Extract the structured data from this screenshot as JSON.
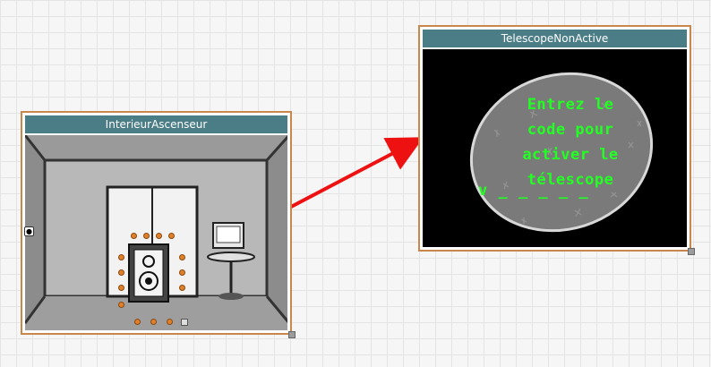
{
  "nodes": {
    "interior": {
      "title": "InterieurAscenseur"
    },
    "telescope": {
      "title": "TelescopeNonActive",
      "screen_text": "Entrez le code pour activer le télescope",
      "code_line": "v _ _ _ _ _"
    }
  },
  "colors": {
    "title_bar": "#4b7d86",
    "node_border": "#c9874b",
    "link_arrow": "#ee1111",
    "hotspot": "#e0802a",
    "screen_text": "#22ff22"
  },
  "icons": {
    "entry_marker": "lock-icon",
    "link": "arrow-link-icon"
  }
}
